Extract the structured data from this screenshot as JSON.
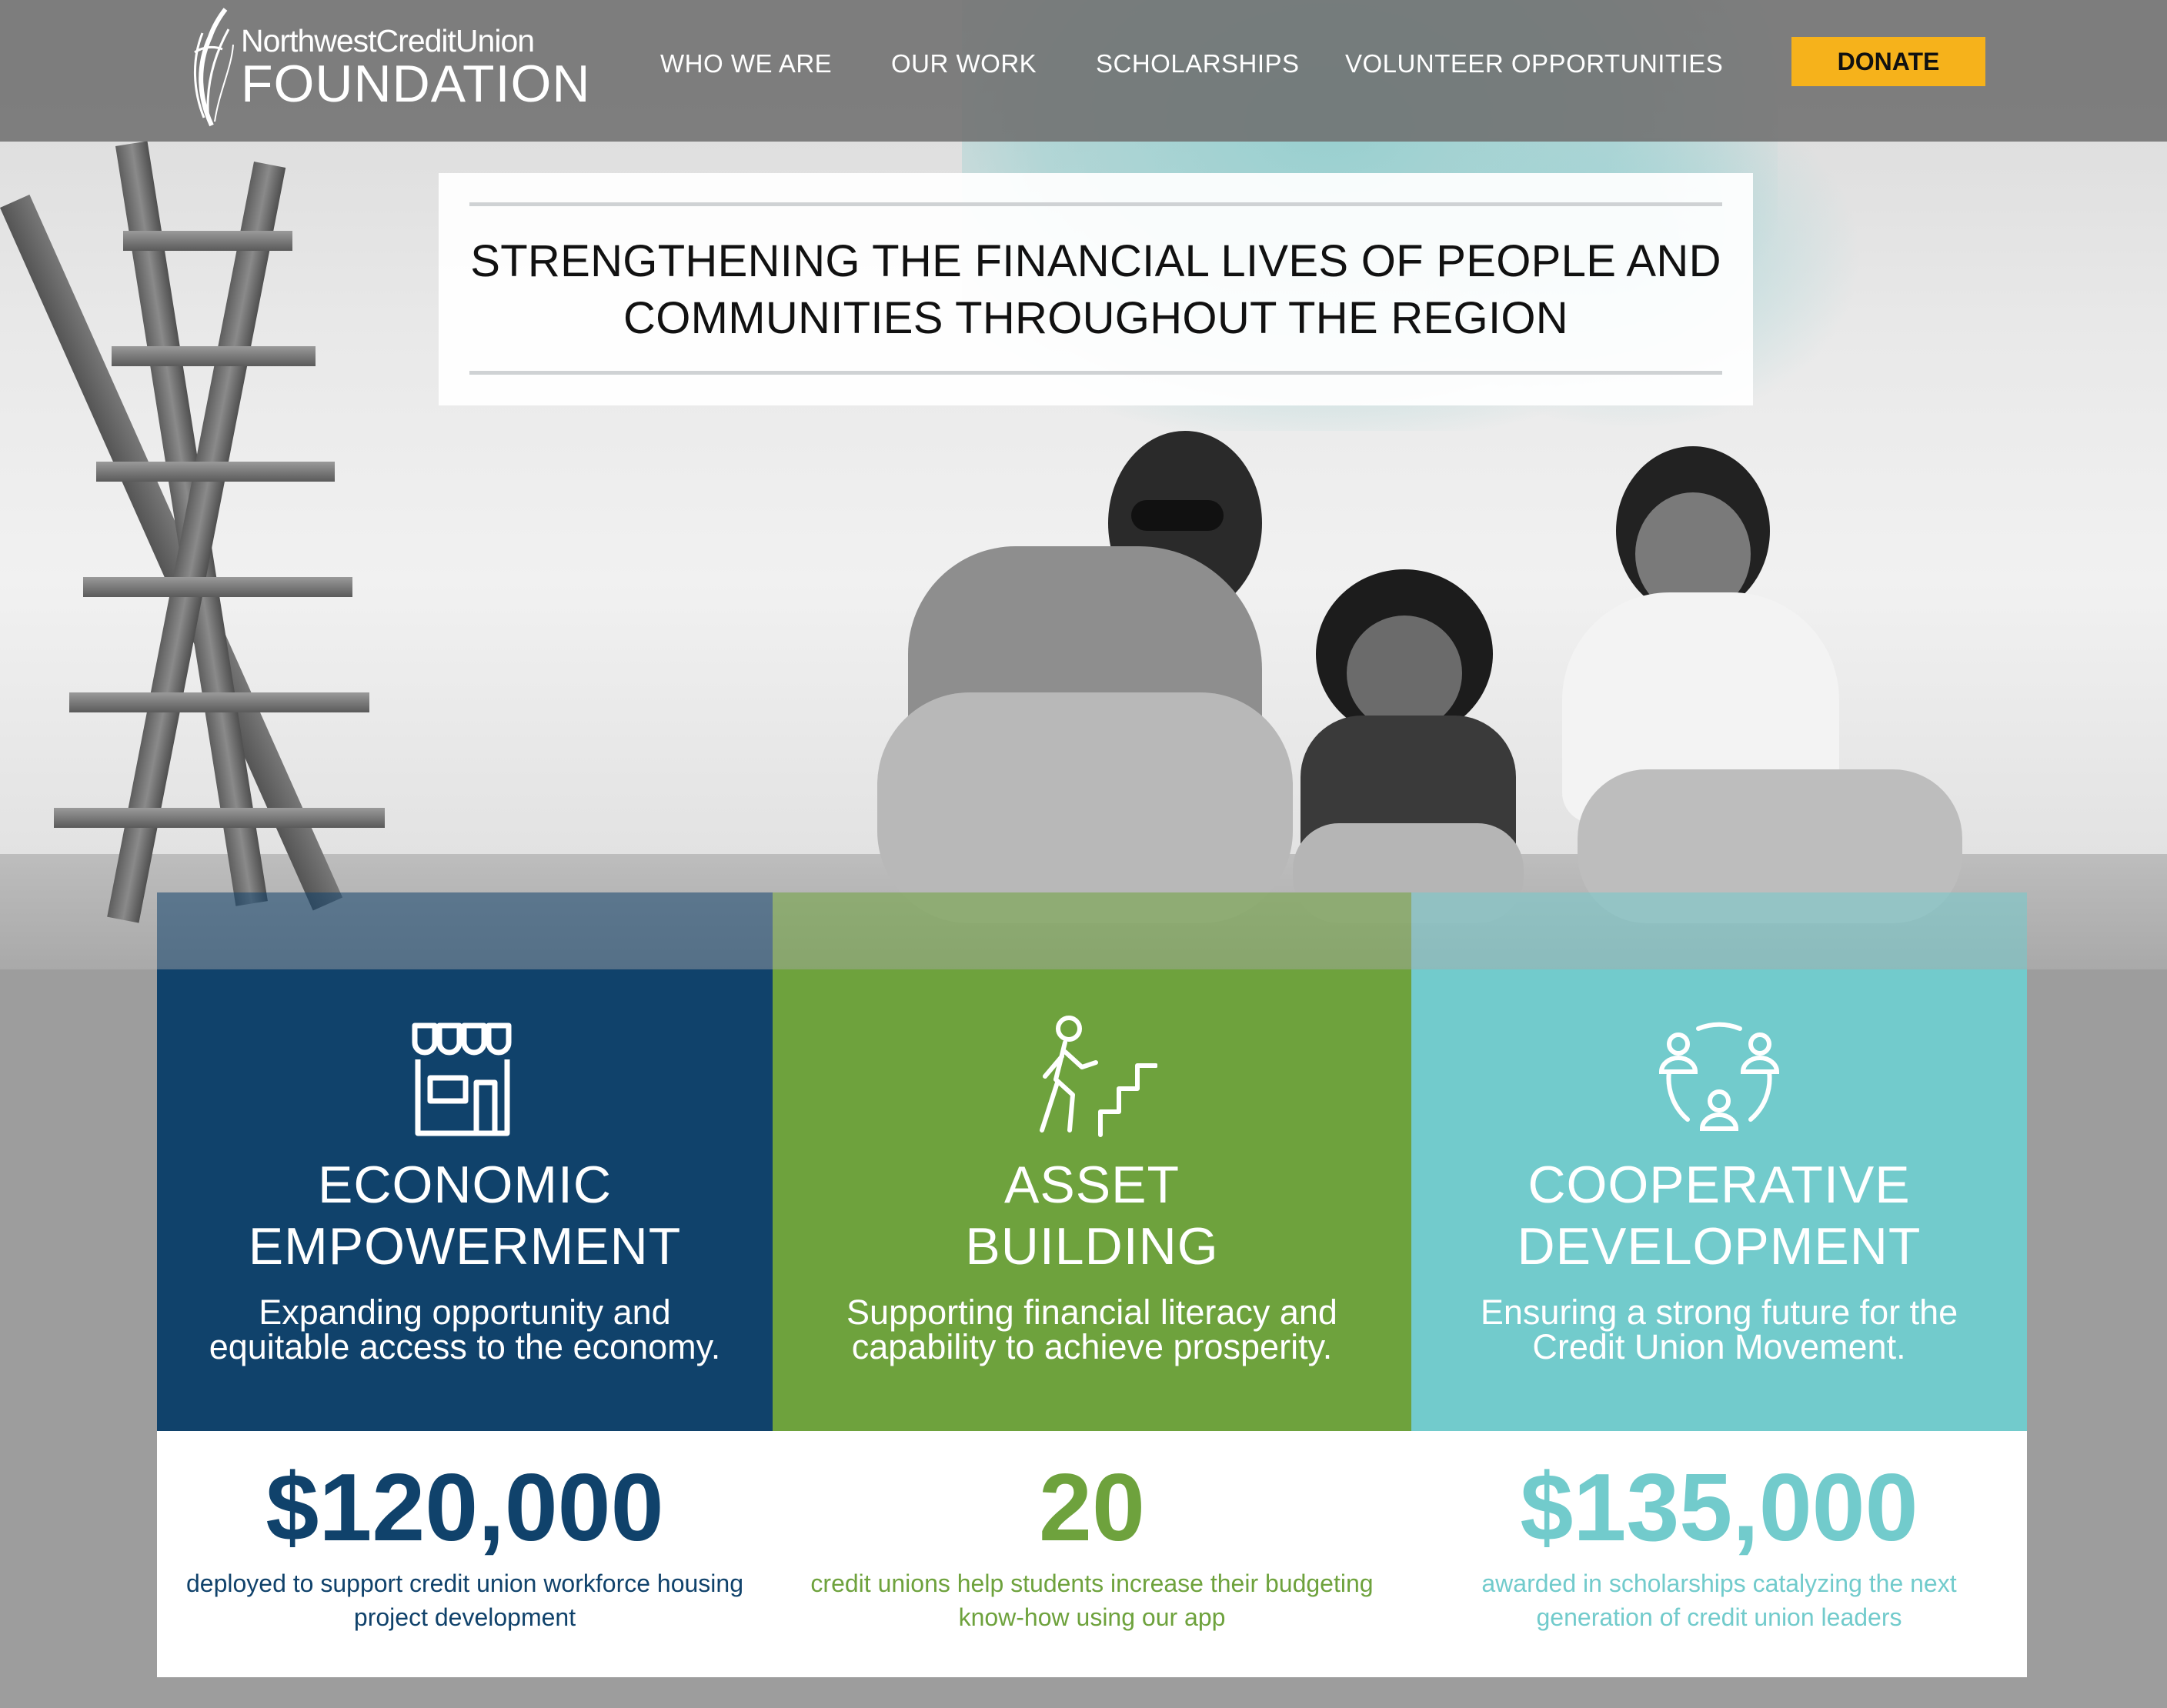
{
  "brand": {
    "logo_line1": "NorthwestCreditUnion",
    "logo_line2": "FOUNDATION"
  },
  "nav": {
    "items": [
      {
        "label": "WHO WE ARE"
      },
      {
        "label": "OUR WORK"
      },
      {
        "label": "SCHOLARSHIPS"
      },
      {
        "label": "VOLUNTEER OPPORTUNITIES"
      }
    ],
    "donate_label": "DONATE"
  },
  "hero": {
    "headline_line1": "STRENGTHENING THE FINANCIAL LIVES OF PEOPLE AND",
    "headline_line2": "COMMUNITIES THROUGHOUT THE REGION"
  },
  "pillars": [
    {
      "icon": "storefront-icon",
      "title_line1": "ECONOMIC",
      "title_line2": "EMPOWERMENT",
      "desc_line1": "Expanding opportunity and",
      "desc_line2": "equitable access to the economy.",
      "color": "#10426b"
    },
    {
      "icon": "person-climbing-stairs-icon",
      "title_line1": "ASSET",
      "title_line2": "BUILDING",
      "desc_line1": "Supporting financial literacy and",
      "desc_line2": "capability to achieve prosperity.",
      "color": "#6ea23d"
    },
    {
      "icon": "people-network-icon",
      "title_line1": "COOPERATIVE",
      "title_line2": "DEVELOPMENT",
      "desc_line1": "Ensuring a strong future for the",
      "desc_line2": "Credit Union Movement.",
      "color": "#72cbcc"
    }
  ],
  "stats": [
    {
      "value": "$120,000",
      "caption_line1": "deployed to support credit union workforce housing",
      "caption_line2": "project development"
    },
    {
      "value": "20",
      "caption_line1": "credit unions help students increase their budgeting",
      "caption_line2": "know-how using our app"
    },
    {
      "value": "$135,000",
      "caption_line1": "awarded in scholarships catalyzing the next",
      "caption_line2": "generation of credit union leaders"
    }
  ],
  "colors": {
    "nav_overlay": "#6e6e6e",
    "donate": "#f6b21b",
    "page_bg": "#9d9d9d"
  }
}
